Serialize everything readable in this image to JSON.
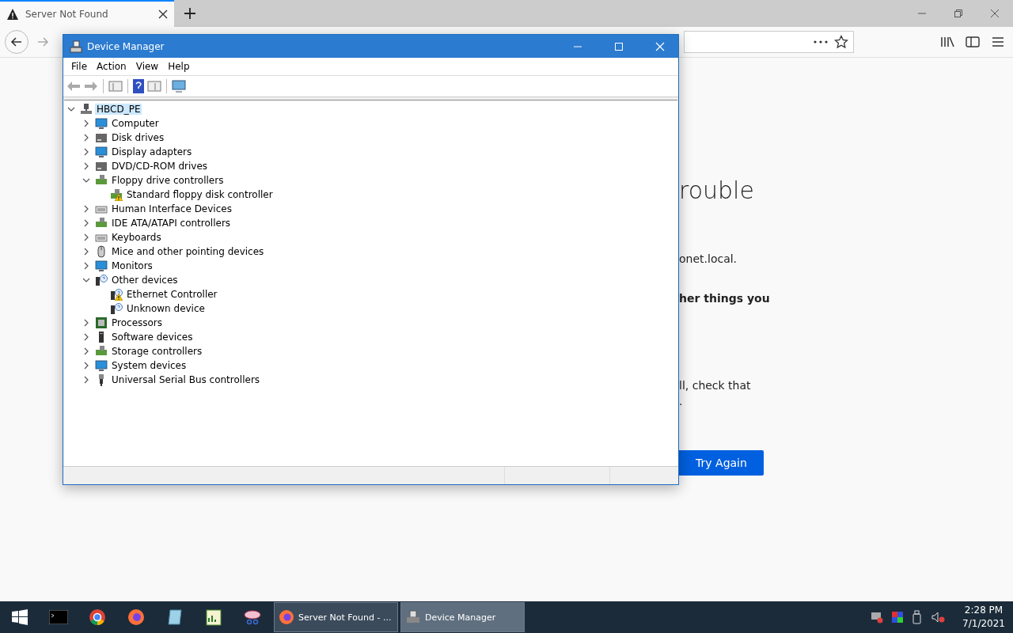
{
  "browser": {
    "tab": {
      "title": "Server Not Found",
      "selected": true
    },
    "page": {
      "heading": "rouble",
      "lines": [
        {
          "text": "onet.local.",
          "bold": false
        },
        {
          "text": "her things you",
          "bold": true
        },
        {
          "text": "ll, check that",
          "bold": false
        },
        {
          "text": ".",
          "bold": false
        }
      ],
      "button": "Try Again"
    }
  },
  "device_manager": {
    "title": "Device Manager",
    "menu": [
      "File",
      "Action",
      "View",
      "Help"
    ],
    "tree": {
      "label": "HBCD_PE",
      "kind": "pc",
      "expanded": true,
      "selected": true,
      "children": [
        {
          "label": "Computer",
          "kind": "monitor",
          "expanded": false,
          "selected": false
        },
        {
          "label": "Disk drives",
          "kind": "drive",
          "expanded": false,
          "selected": false
        },
        {
          "label": "Display adapters",
          "kind": "monitor",
          "expanded": false,
          "selected": false
        },
        {
          "label": "DVD/CD-ROM drives",
          "kind": "drive",
          "expanded": false,
          "selected": false
        },
        {
          "label": "Floppy drive controllers",
          "kind": "card",
          "expanded": true,
          "selected": false,
          "children": [
            {
              "label": "Standard floppy disk controller",
              "kind": "card",
              "warning": true,
              "selected": false
            }
          ]
        },
        {
          "label": "Human Interface Devices",
          "kind": "keyboard",
          "expanded": false,
          "selected": false
        },
        {
          "label": "IDE ATA/ATAPI controllers",
          "kind": "card",
          "expanded": false,
          "selected": false
        },
        {
          "label": "Keyboards",
          "kind": "keyboard",
          "expanded": false,
          "selected": false
        },
        {
          "label": "Mice and other pointing devices",
          "kind": "mouse",
          "expanded": false,
          "selected": false
        },
        {
          "label": "Monitors",
          "kind": "monitor",
          "expanded": false,
          "selected": false
        },
        {
          "label": "Other devices",
          "kind": "unknown",
          "expanded": true,
          "selected": false,
          "children": [
            {
              "label": "Ethernet Controller",
              "kind": "unknown",
              "warning": true,
              "selected": false
            },
            {
              "label": "Unknown device",
              "kind": "unknown",
              "warning": false,
              "selected": false
            }
          ]
        },
        {
          "label": "Processors",
          "kind": "chip",
          "expanded": false,
          "selected": false
        },
        {
          "label": "Software devices",
          "kind": "tower",
          "expanded": false,
          "selected": false
        },
        {
          "label": "Storage controllers",
          "kind": "card",
          "expanded": false,
          "selected": false
        },
        {
          "label": "System devices",
          "kind": "monitor",
          "expanded": false,
          "selected": false
        },
        {
          "label": "Universal Serial Bus controllers",
          "kind": "usb",
          "expanded": false,
          "selected": false
        }
      ]
    }
  },
  "taskbar": {
    "windows": [
      {
        "label": "Server Not Found - ...",
        "kind": "browser",
        "selected": false
      },
      {
        "label": "Device Manager",
        "kind": "devmgr",
        "selected": true
      }
    ],
    "clock": {
      "time": "2:28 PM",
      "date": "7/1/2021"
    }
  }
}
